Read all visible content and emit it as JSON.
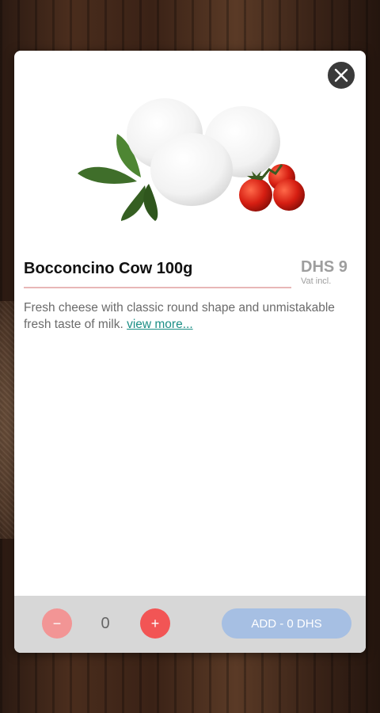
{
  "product": {
    "name": "Bocconcino Cow 100g",
    "price": "DHS 9",
    "vat_note": "Vat incl.",
    "description": "Fresh cheese with classic round shape and unmistakable fresh taste of milk. ",
    "view_more_label": "view more...",
    "image_icon": "mozzarella-basil-tomato-image"
  },
  "controls": {
    "close_icon": "close-icon",
    "minus_label": "−",
    "plus_label": "+",
    "quantity": "0",
    "add_label": "ADD - 0 DHS"
  },
  "colors": {
    "accent_red": "#f25555",
    "link_teal": "#1d8f86",
    "add_button": "#a6bfe3"
  }
}
